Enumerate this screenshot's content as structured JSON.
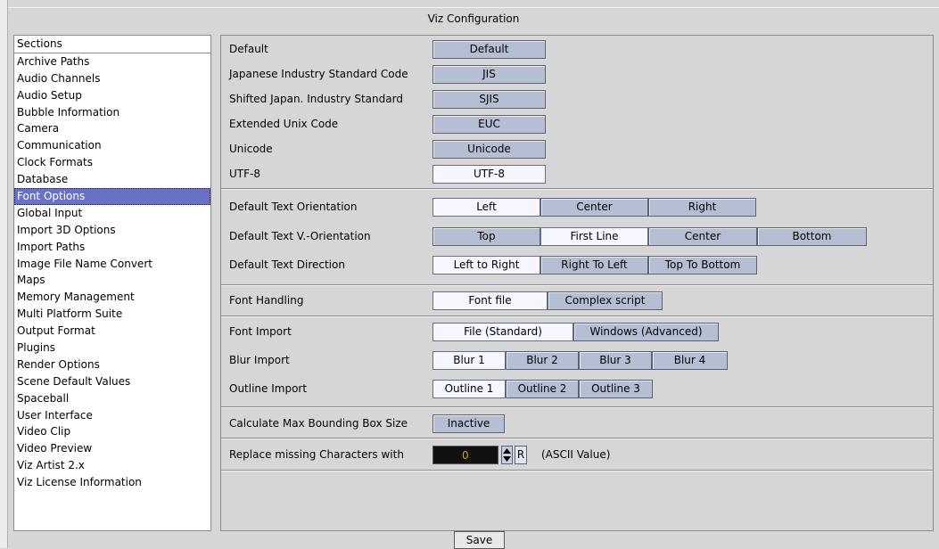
{
  "window": {
    "title": "Viz Configuration"
  },
  "sidebar": {
    "header": "Sections",
    "selected": "Font Options",
    "items": [
      "Archive Paths",
      "Audio Channels",
      "Audio Setup",
      "Bubble Information",
      "Camera",
      "Communication",
      "Clock Formats",
      "Database",
      "Font Options",
      "Global Input",
      "Import 3D Options",
      "Import Paths",
      "Image File Name Convert",
      "Maps",
      "Memory Management",
      "Multi Platform Suite",
      "Output Format",
      "Plugins",
      "Render Options",
      "Scene Default Values",
      "Spaceball",
      "User Interface",
      "Video Clip",
      "Video Preview",
      "Viz Artist 2.x",
      "Viz License Information"
    ]
  },
  "encoding": {
    "default_label": "Default",
    "default_btn": "Default",
    "jis_label": "Japanese Industry Standard Code",
    "jis_btn": "JIS",
    "sjis_label": "Shifted Japan. Industry Standard",
    "sjis_btn": "SJIS",
    "euc_label": "Extended Unix Code",
    "euc_btn": "EUC",
    "unicode_label": "Unicode",
    "unicode_btn": "Unicode",
    "utf8_label": "UTF-8",
    "utf8_btn": "UTF-8",
    "selected": "UTF-8"
  },
  "orientation": {
    "text_label": "Default Text Orientation",
    "text_options": [
      "Left",
      "Center",
      "Right"
    ],
    "text_selected": "Left",
    "v_label": "Default Text V.-Orientation",
    "v_options": [
      "Top",
      "First Line",
      "Center",
      "Bottom"
    ],
    "v_selected": "First Line",
    "dir_label": "Default Text Direction",
    "dir_options": [
      "Left to Right",
      "Right To Left",
      "Top To Bottom"
    ],
    "dir_selected": "Left to Right"
  },
  "font_handling": {
    "label": "Font Handling",
    "options": [
      "Font file",
      "Complex script"
    ],
    "selected": "Font file"
  },
  "import": {
    "font_label": "Font Import",
    "font_options": [
      "File (Standard)",
      "Windows (Advanced)"
    ],
    "font_selected": "File (Standard)",
    "blur_label": "Blur Import",
    "blur_options": [
      "Blur 1",
      "Blur 2",
      "Blur 3",
      "Blur 4"
    ],
    "blur_selected": "Blur 1",
    "outline_label": "Outline Import",
    "outline_options": [
      "Outline 1",
      "Outline 2",
      "Outline 3"
    ],
    "outline_selected": "Outline 1"
  },
  "bbox": {
    "label": "Calculate Max Bounding Box Size",
    "button": "Inactive"
  },
  "replace": {
    "label": "Replace missing Characters with",
    "value": "0",
    "reset_btn": "R",
    "unit": "(ASCII Value)"
  },
  "footer": {
    "save": "Save"
  },
  "colors": {
    "button": "#b5bed2",
    "button_active": "#f5f6ff",
    "selection": "#6a71c4",
    "field_text": "#e0a000"
  }
}
